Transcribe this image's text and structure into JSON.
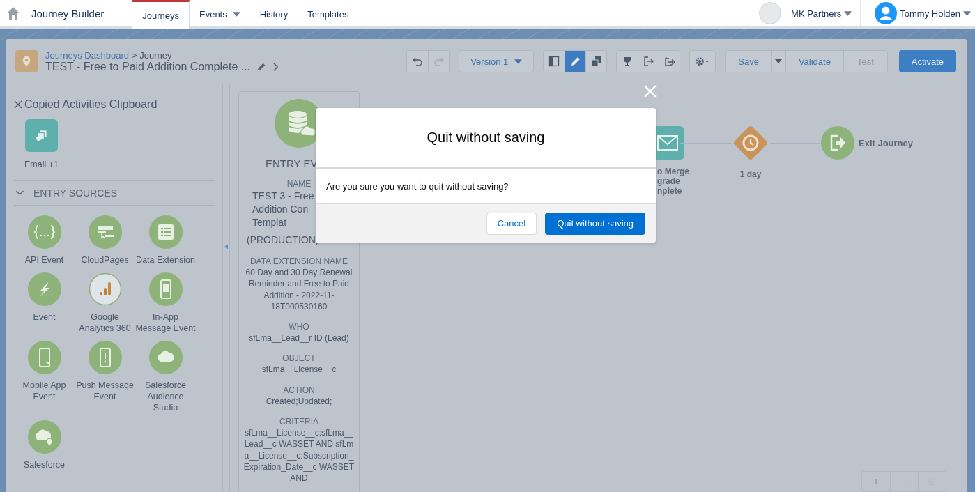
{
  "nav": {
    "app_title": "Journey Builder",
    "tabs": [
      {
        "label": "Journeys",
        "selected": true,
        "has_menu": false
      },
      {
        "label": "Events",
        "selected": false,
        "has_menu": true
      },
      {
        "label": "History",
        "selected": false,
        "has_menu": false
      },
      {
        "label": "Templates",
        "selected": false,
        "has_menu": false
      }
    ],
    "org": "MK Partners",
    "user": "Tommy Holden"
  },
  "journey": {
    "breadcrumb_link": "Journeys Dashboard",
    "breadcrumb_current": "> Journey",
    "title": "TEST - Free to Paid Addition Complete ..."
  },
  "toolbar": {
    "version": "Version 1",
    "view_buttons": [
      {
        "kind": "panel",
        "selected": false
      },
      {
        "kind": "pencil",
        "selected": true
      },
      {
        "kind": "copy",
        "selected": false
      }
    ],
    "save": "Save",
    "validate": "Validate",
    "test": {
      "label": "Test",
      "disabled": true
    },
    "activate": "Activate"
  },
  "clipboard": {
    "title": "Copied Activities Clipboard",
    "items": [
      {
        "label": "Email +1"
      }
    ]
  },
  "entry_sources": {
    "title": "ENTRY SOURCES",
    "expanded": true,
    "items": [
      {
        "label": "API Event",
        "kind": "api"
      },
      {
        "label": "CloudPages",
        "kind": "cloudpages"
      },
      {
        "label": "Data Extension",
        "kind": "data_extension"
      },
      {
        "label": "Event",
        "kind": "event"
      },
      {
        "label": "Google Analytics 360",
        "kind": "analytics"
      },
      {
        "label": "In-App Message Event",
        "kind": "inapp"
      },
      {
        "label": "Mobile App Event",
        "kind": "mobile"
      },
      {
        "label": "Push Message Event",
        "kind": "push"
      },
      {
        "label": "Salesforce Audience Studio",
        "kind": "audience"
      },
      {
        "label": "Salesforce",
        "kind": "sfdata"
      }
    ]
  },
  "entry_event": {
    "title": "ENTRY EV",
    "fields": [
      {
        "label": "NAME",
        "lines": [
          "TEST 3 - Free",
          "Addition Con",
          "Templat",
          "(PRODUCTION)"
        ]
      },
      {
        "label": "DATA EXTENSION NAME",
        "value": "60 Day and 30 Day Renewal Reminder and Free to Paid Addition - 2022-11-18T000530160"
      },
      {
        "label": "WHO",
        "value": "sfLma__Lead__r ID (Lead)"
      },
      {
        "label": "OBJECT",
        "value": "sfLma__License__c"
      },
      {
        "label": "ACTION",
        "value": "Created;Updated;"
      },
      {
        "label": "CRITERIA",
        "value": "sfLma__License__c:sfLma__Lead__c WASSET AND sfLma__License__c:Subscription_Expiration_Date__c WASSET AND"
      }
    ]
  },
  "canvas": {
    "nodes": [
      {
        "kind": "email",
        "lines": [
          "o Merge",
          "grade",
          "nplete"
        ]
      },
      {
        "kind": "wait",
        "lines": [
          "1 day"
        ]
      },
      {
        "kind": "exit",
        "lines": [
          "Exit Journey"
        ]
      }
    ],
    "zoom_controls": [
      "+",
      "-"
    ]
  },
  "modal": {
    "title": "Quit without saving",
    "message": "Are you sure you want to quit without saving?",
    "buttons": [
      {
        "label": "Cancel",
        "kind": "neutral"
      },
      {
        "label": "Quit without saving",
        "kind": "brand"
      }
    ]
  }
}
